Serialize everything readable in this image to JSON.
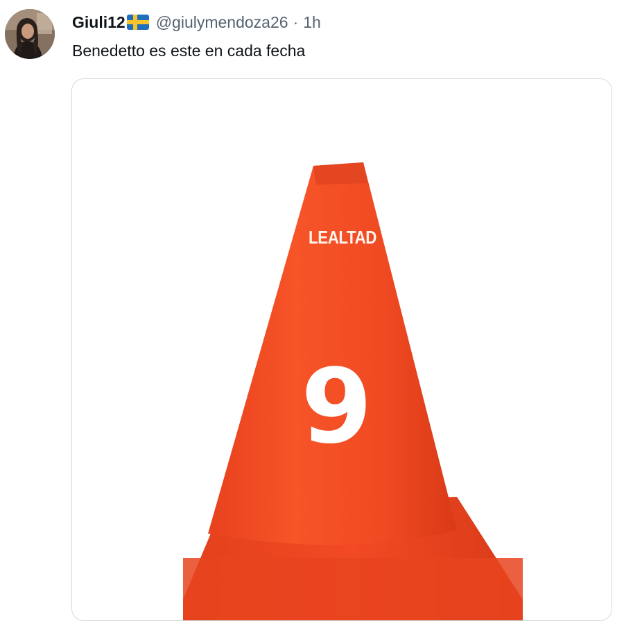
{
  "tweet": {
    "display_name": "Giuli12",
    "handle": "@giulymendoza26",
    "separator": "·",
    "time": "1h",
    "text": "Benedetto es este en cada fecha",
    "flag_icon": "sweden-flag-icon"
  },
  "media": {
    "caption": "LEALTAD",
    "number": "9",
    "cone_color": "#f24a23"
  },
  "colors": {
    "text_primary": "#0f1419",
    "text_secondary": "#536471",
    "border": "#cfd9de"
  }
}
